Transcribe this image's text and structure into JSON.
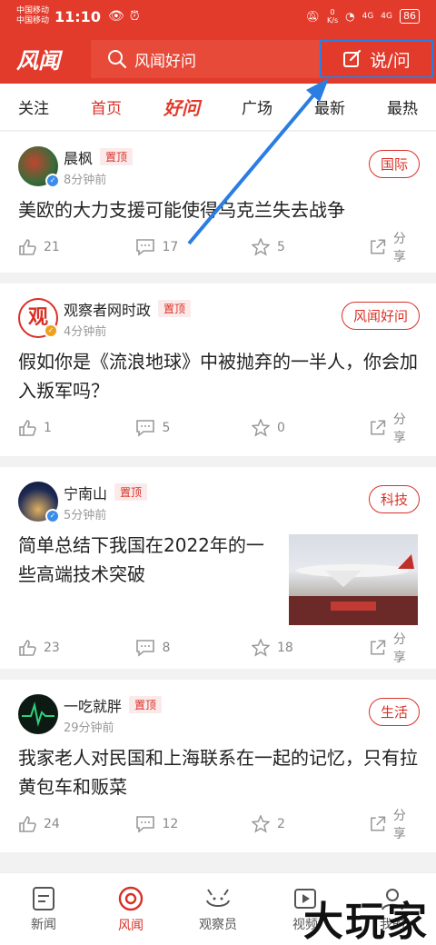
{
  "status": {
    "carrier1": "中国移动",
    "carrier2": "中国移动",
    "time": "11:10",
    "netspeed_value": "0",
    "netspeed_unit": "K/s",
    "signal1": "4G",
    "signal2": "4G",
    "battery": "86"
  },
  "header": {
    "logo": "风闻",
    "search_placeholder": "风闻好问",
    "post_label": "说/问"
  },
  "tabs": [
    {
      "label": "关注"
    },
    {
      "label": "首页"
    },
    {
      "label": "好问"
    },
    {
      "label": "广场"
    },
    {
      "label": "最新"
    },
    {
      "label": "最热"
    }
  ],
  "feed": [
    {
      "author": "晨枫",
      "pin": "置顶",
      "time": "8分钟前",
      "category": "国际",
      "title": "美欧的大力支援可能使得乌克兰失去战争",
      "likes": "21",
      "comments": "17",
      "favs": "5",
      "share": "分享"
    },
    {
      "author": "观察者网时政",
      "pin": "置顶",
      "time": "4分钟前",
      "category": "风闻好问",
      "title": "假如你是《流浪地球》中被抛弃的一半人，你会加入叛军吗？",
      "likes": "1",
      "comments": "5",
      "favs": "0",
      "share": "分享"
    },
    {
      "author": "宁南山",
      "pin": "置顶",
      "time": "5分钟前",
      "category": "科技",
      "title": "简单总结下我国在2022年的一些高端技术突破",
      "likes": "23",
      "comments": "8",
      "favs": "18",
      "share": "分享"
    },
    {
      "author": "一吃就胖",
      "pin": "置顶",
      "time": "29分钟前",
      "category": "生活",
      "title": "我家老人对民国和上海联系在一起的记忆，只有拉黄包车和贩菜",
      "likes": "24",
      "comments": "12",
      "favs": "2",
      "share": "分享"
    }
  ],
  "bottom_nav": [
    {
      "label": "新闻"
    },
    {
      "label": "风闻"
    },
    {
      "label": "观察员"
    },
    {
      "label": "视频"
    },
    {
      "label": "我的"
    }
  ],
  "watermark": "大玩家",
  "colors": {
    "brand": "#e23b2c",
    "accent": "#d93026",
    "highlight": "#2a7de1"
  }
}
